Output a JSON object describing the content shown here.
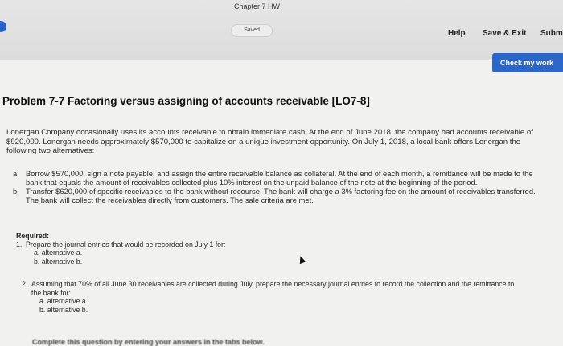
{
  "topbar": {
    "tab_title": "Chapter 7 HW",
    "saved_label": "Saved",
    "help_label": "Help",
    "save_exit_label": "Save & Exit",
    "submit_label": "Submi"
  },
  "check_button_label": "Check my work",
  "problem": {
    "title": "Problem 7-7 Factoring versus assigning of accounts receivable [LO7-8]",
    "intro": "Lonergan Company occasionally uses its accounts receivable to obtain immediate cash. At the end of June 2018, the company had accounts receivable of $920,000. Lonergan needs approximately $570,000 to capitalize on a unique investment opportunity. On July 1, 2018, a local bank offers Lonergan the following two alternatives:",
    "alternatives": [
      {
        "letter": "a.",
        "text": "Borrow $570,000, sign a note payable, and assign the entire receivable balance as collateral. At the end of each month, a remittance will be made to the bank that equals the amount of receivables collected plus 10% interest on the unpaid balance of the note at the beginning of the period."
      },
      {
        "letter": "b.",
        "text": "Transfer $620,000 of specific receivables to the bank without recourse. The bank will charge a 3% factoring fee on the amount of receivables transferred. The bank will collect the receivables directly from customers. The sale criteria are met."
      }
    ]
  },
  "required": {
    "title": "Required:",
    "items": [
      {
        "num": "1.",
        "text": "Prepare the journal entries that would be recorded on July 1 for:",
        "subs": [
          "a. alternative a.",
          "b. alternative b."
        ]
      },
      {
        "num": "2.",
        "text": "Assuming that 70% of all June 30 receivables are collected during July, prepare the necessary journal entries to record the collection and the remittance to the bank for:",
        "subs": [
          "a. alternative a.",
          "b. alternative b."
        ]
      }
    ]
  },
  "complete_instruction": "Complete this question by entering your answers in the tabs below.",
  "colors": {
    "accent": "#2b66c9",
    "background": "#f1f1f0"
  }
}
